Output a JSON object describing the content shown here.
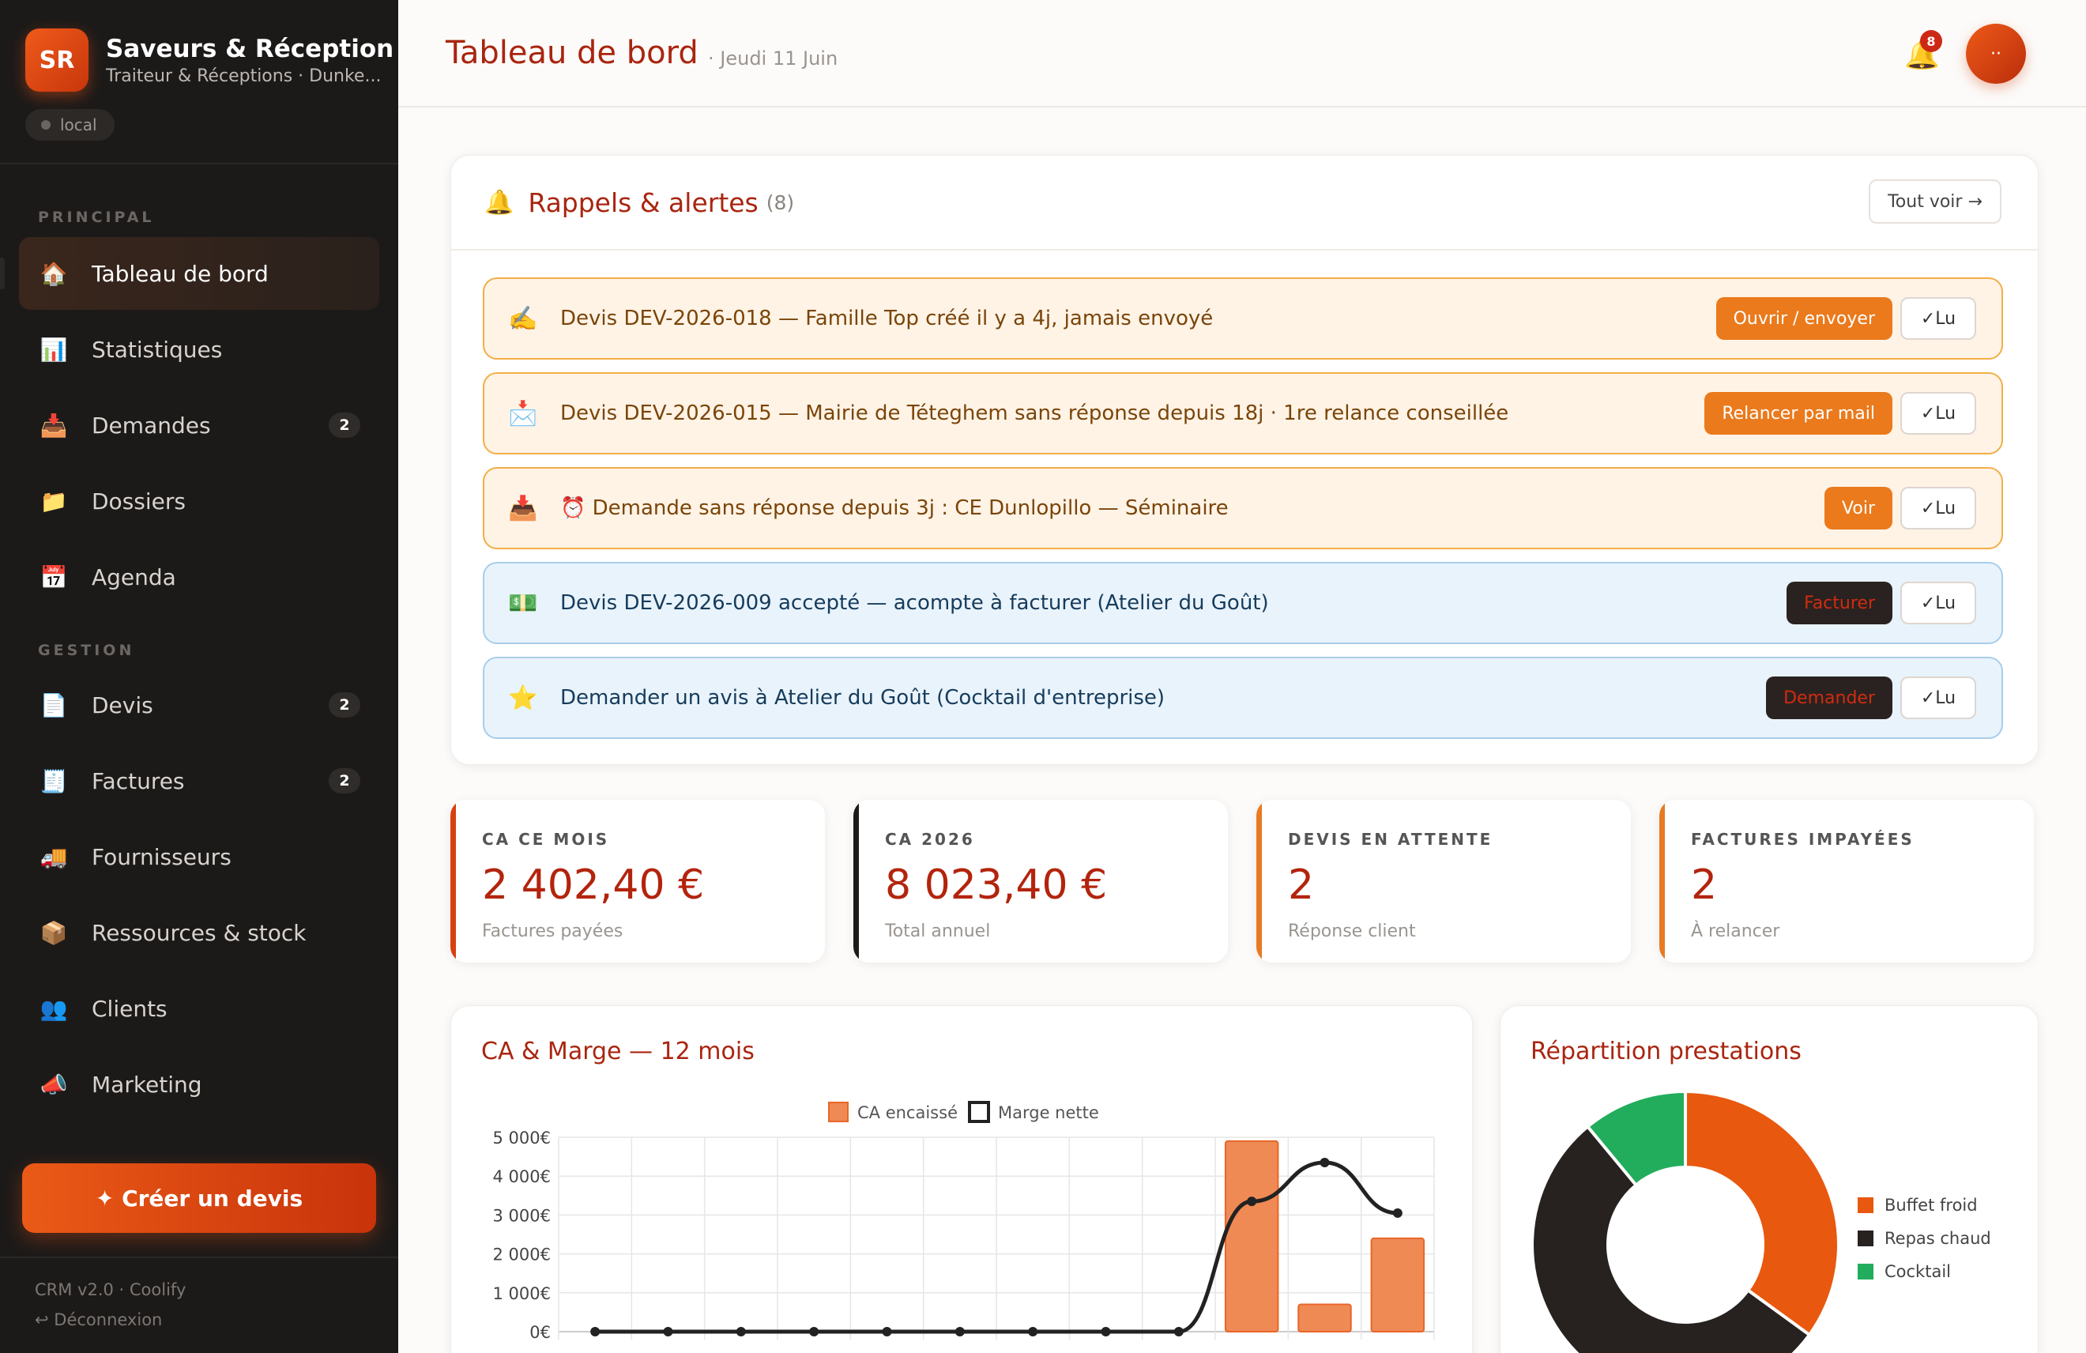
{
  "brand": {
    "initials": "SR",
    "name": "Saveurs & Réception",
    "subtitle": "Traiteur & Réceptions · Dunke...",
    "env": "local"
  },
  "sidebar": {
    "sections": [
      "PRINCIPAL",
      "GESTION"
    ],
    "items": [
      {
        "label": "Tableau de bord",
        "icon": "🏠",
        "icon_name": "home-icon",
        "badge": ""
      },
      {
        "label": "Statistiques",
        "icon": "📊",
        "icon_name": "bar-chart-icon",
        "badge": ""
      },
      {
        "label": "Demandes",
        "icon": "📥",
        "icon_name": "inbox-tray-icon",
        "badge": "2"
      },
      {
        "label": "Dossiers",
        "icon": "📁",
        "icon_name": "folder-icon",
        "badge": ""
      },
      {
        "label": "Agenda",
        "icon": "📅",
        "icon_name": "calendar-icon",
        "badge": ""
      },
      {
        "label": "Devis",
        "icon": "📄",
        "icon_name": "document-icon",
        "badge": "2"
      },
      {
        "label": "Factures",
        "icon": "🧾",
        "icon_name": "receipt-icon",
        "badge": "2"
      },
      {
        "label": "Fournisseurs",
        "icon": "🚚",
        "icon_name": "truck-icon",
        "badge": ""
      },
      {
        "label": "Ressources & stock",
        "icon": "📦",
        "icon_name": "package-icon",
        "badge": ""
      },
      {
        "label": "Clients",
        "icon": "👥",
        "icon_name": "users-icon",
        "badge": ""
      },
      {
        "label": "Marketing",
        "icon": "📣",
        "icon_name": "megaphone-icon",
        "badge": ""
      }
    ],
    "create_button": "✦ Créer un devis",
    "footer_version": "CRM v2.0 · Coolify",
    "logout": "↩ Déconnexion"
  },
  "header": {
    "title": "Tableau de bord",
    "date": "· Jeudi 11 Juin",
    "notif_count": "8",
    "avatar_text": "··"
  },
  "reminders": {
    "title": "Rappels & alertes",
    "count": "(8)",
    "see_all": "Tout voir →",
    "items": [
      {
        "icon": "✍️",
        "icon_name": "writing-hand-icon",
        "text": "Devis DEV-2026-018 — Famille Top créé il y a 4j, jamais envoyé",
        "action": "Ouvrir / envoyer",
        "variant": "warn",
        "action_style": "orange",
        "read": "✓Lu"
      },
      {
        "icon": "📩",
        "icon_name": "envelope-icon",
        "text": "Devis DEV-2026-015 — Mairie de Téteghem sans réponse depuis 18j · 1re relance conseillée",
        "action": "Relancer par mail",
        "variant": "warn",
        "action_style": "orange",
        "read": "✓Lu"
      },
      {
        "icon": "📥",
        "icon_name": "inbox-tray-icon",
        "text": "⏰ Demande sans réponse depuis 3j : CE Dunlopillo — Séminaire",
        "action": "Voir",
        "variant": "warn",
        "action_style": "orange",
        "read": "✓Lu"
      },
      {
        "icon": "💵",
        "icon_name": "money-icon",
        "text": "Devis DEV-2026-009 accepté — acompte à facturer (Atelier du Goût)",
        "action": "Facturer",
        "variant": "info",
        "action_style": "dark",
        "read": "✓Lu"
      },
      {
        "icon": "⭐",
        "icon_name": "star-icon",
        "text": "Demander un avis à Atelier du Goût (Cocktail d'entreprise)",
        "action": "Demander",
        "variant": "info",
        "action_style": "dark",
        "read": "✓Lu"
      }
    ]
  },
  "kpis": [
    {
      "label": "CA CE MOIS",
      "value": "2 402,40 €",
      "sub": "Factures payées",
      "accent": "#d8400f"
    },
    {
      "label": "CA 2026",
      "value": "8 023,40 €",
      "sub": "Total annuel",
      "accent": "#1c1a19"
    },
    {
      "label": "DEVIS EN ATTENTE",
      "value": "2",
      "sub": "Réponse client",
      "accent": "#e87a22"
    },
    {
      "label": "FACTURES IMPAYÉES",
      "value": "2",
      "sub": "À relancer",
      "accent": "#e87a22"
    }
  ],
  "chart_data": [
    {
      "type": "bar",
      "title": "CA & Marge — 12 mois",
      "y_ticks": [
        "0€",
        "1 000€",
        "2 000€",
        "3 000€",
        "4 000€",
        "5 000€"
      ],
      "ylim": [
        0,
        5000
      ],
      "legend_position": "top",
      "series": [
        {
          "name": "CA encaissé",
          "type": "bar",
          "color": "#ef8a55",
          "values": [
            0,
            0,
            0,
            0,
            0,
            0,
            0,
            0,
            0,
            4900,
            700,
            2400
          ]
        },
        {
          "name": "Marge nette",
          "type": "line",
          "color": "#222222",
          "values": [
            0,
            0,
            0,
            0,
            0,
            0,
            0,
            0,
            0,
            3350,
            4350,
            3050
          ]
        }
      ]
    },
    {
      "type": "pie",
      "title": "Répartition prestations",
      "legend_position": "right",
      "slices": [
        {
          "name": "Buffet froid",
          "value": 35,
          "color": "#e8580f"
        },
        {
          "name": "Repas chaud",
          "value": 54,
          "color": "#272220"
        },
        {
          "name": "Cocktail",
          "value": 11,
          "color": "#22ad5c"
        }
      ]
    }
  ]
}
